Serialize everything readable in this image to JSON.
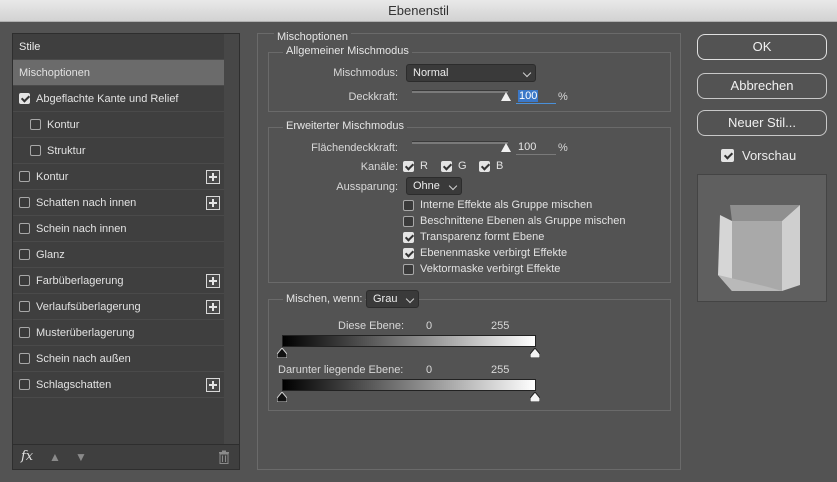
{
  "window": {
    "title": "Ebenenstil"
  },
  "style_list": {
    "header": "Stile",
    "items": [
      {
        "label": "Mischoptionen",
        "selected": true
      },
      {
        "label": "Abgeflachte Kante und Relief",
        "checked": true
      },
      {
        "label": "Kontur",
        "checked": false
      },
      {
        "label": "Struktur",
        "checked": false
      },
      {
        "label": "Kontur",
        "checked": false,
        "add": true
      },
      {
        "label": "Schatten nach innen",
        "checked": false,
        "add": true
      },
      {
        "label": "Schein nach innen",
        "checked": false
      },
      {
        "label": "Glanz",
        "checked": false
      },
      {
        "label": "Farbüberlagerung",
        "checked": false,
        "add": true
      },
      {
        "label": "Verlaufsüberlagerung",
        "checked": false,
        "add": true
      },
      {
        "label": "Musterüberlagerung",
        "checked": false
      },
      {
        "label": "Schein nach außen",
        "checked": false
      },
      {
        "label": "Schlagschatten",
        "checked": false,
        "add": true
      }
    ],
    "footer": {
      "fx_label": "fx"
    }
  },
  "blending": {
    "title": "Mischoptionen",
    "general": {
      "title": "Allgemeiner Mischmodus",
      "mode_label": "Mischmodus:",
      "mode_value": "Normal",
      "opacity_label": "Deckkraft:",
      "opacity_value": "100",
      "opacity_unit": "%"
    },
    "advanced": {
      "title": "Erweiterter Mischmodus",
      "fill_label": "Flächendeckkraft:",
      "fill_value": "100",
      "fill_unit": "%",
      "channels_label": "Kanäle:",
      "channels": [
        {
          "label": "R",
          "checked": true
        },
        {
          "label": "G",
          "checked": true
        },
        {
          "label": "B",
          "checked": true
        }
      ],
      "knockout_label": "Aussparung:",
      "knockout_value": "Ohne",
      "options": [
        {
          "label": "Interne Effekte als Gruppe mischen",
          "checked": false
        },
        {
          "label": "Beschnittene Ebenen als Gruppe mischen",
          "checked": false
        },
        {
          "label": "Transparenz formt Ebene",
          "checked": true
        },
        {
          "label": "Ebenenmaske verbirgt Effekte",
          "checked": true
        },
        {
          "label": "Vektormaske verbirgt Effekte",
          "checked": false
        }
      ]
    },
    "blend_if": {
      "label": "Mischen, wenn:",
      "channel_value": "Grau",
      "this_layer_label": "Diese Ebene:",
      "this_layer_min": "0",
      "this_layer_max": "255",
      "underlying_label": "Darunter liegende Ebene:",
      "underlying_min": "0",
      "underlying_max": "255"
    }
  },
  "buttons": {
    "ok": "OK",
    "cancel": "Abbrechen",
    "new_style": "Neuer Stil..."
  },
  "preview": {
    "label": "Vorschau",
    "checked": true
  }
}
